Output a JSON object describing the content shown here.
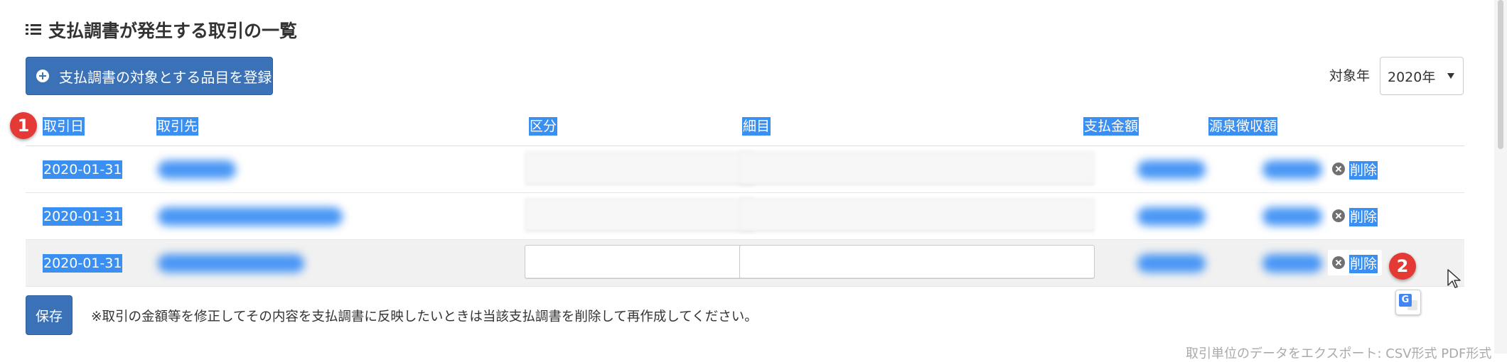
{
  "page": {
    "title": "支払調書が発生する取引の一覧",
    "list_icon": "list-icon"
  },
  "toolbar": {
    "register_label": "支払調書の対象とする品目を登録",
    "register_icon": "plus-circle-icon",
    "year_label": "対象年",
    "year_value": "2020年"
  },
  "table": {
    "columns": [
      "取引日",
      "取引先",
      "区分",
      "細目",
      "支払金額",
      "源泉徴収額"
    ],
    "rows": [
      {
        "date": "2020-01-31",
        "delete_label": "削除"
      },
      {
        "date": "2020-01-31",
        "delete_label": "削除"
      },
      {
        "date": "2020-01-31",
        "delete_label": "削除"
      }
    ]
  },
  "badges": [
    "1",
    "2"
  ],
  "footer": {
    "save_label": "保存",
    "note": "※取引の金額等を修正してその内容を支払調書に反映したいときは当該支払調書を削除して再作成してください。",
    "export_text": "取引単位のデータをエクスポート: CSV形式 PDF形式"
  },
  "colors": {
    "primary": "#3b72b7",
    "selection": "#3a8ff0",
    "badge": "#e53935"
  }
}
